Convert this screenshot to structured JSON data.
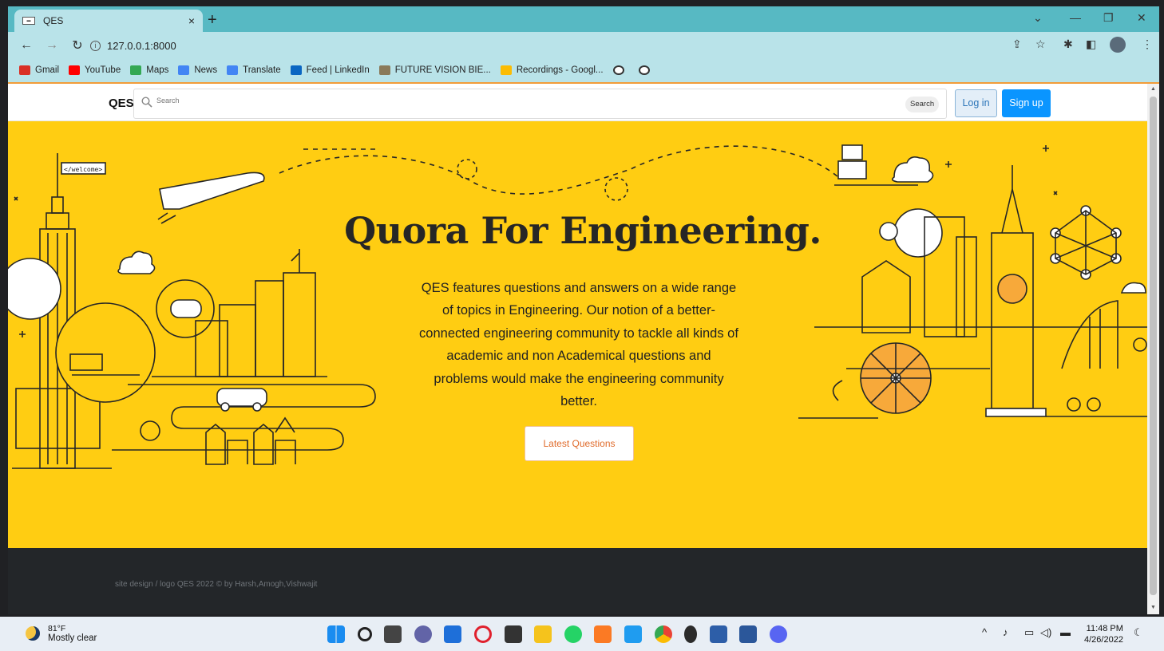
{
  "browser": {
    "tab_title": "QES",
    "tab_close": "×",
    "new_tab": "+",
    "url": "127.0.0.1:8000",
    "bookmarks": [
      {
        "label": "Gmail",
        "color": "#d93025"
      },
      {
        "label": "YouTube",
        "color": "#ff0000"
      },
      {
        "label": "Maps",
        "color": "#34a853"
      },
      {
        "label": "News",
        "color": "#4285f4"
      },
      {
        "label": "Translate",
        "color": "#4285f4"
      },
      {
        "label": "Feed | LinkedIn",
        "color": "#0a66c2"
      },
      {
        "label": "FUTURE VISION BIE...",
        "color": "#8a7a5a"
      },
      {
        "label": "Recordings - Googl...",
        "color": "#fbbc04"
      }
    ]
  },
  "site": {
    "brand": "QES",
    "search_placeholder": "Search",
    "search_button": "Search",
    "login": "Log in",
    "signup": "Sign up",
    "hero_title": "Quora For Engineering.",
    "hero_text": "QES features questions and answers on a wide range of topics in Engineering. Our notion of a better-connected engineering community to tackle all kinds of academic and non Academical questions and problems would make the engineering community better.",
    "cta": "Latest Questions",
    "footer": "site design / logo QES 2022 © by Harsh,Amogh,Vishwajit",
    "illustration_label": "</welcome>"
  },
  "taskbar": {
    "temperature": "81°F",
    "weather": "Mostly clear",
    "time": "11:48 PM",
    "date": "4/26/2022"
  },
  "colors": {
    "hero_bg": "#ffcd12",
    "footer_bg": "#232629",
    "signup_bg": "#0a95ff",
    "cta_text": "#e06b2b"
  }
}
